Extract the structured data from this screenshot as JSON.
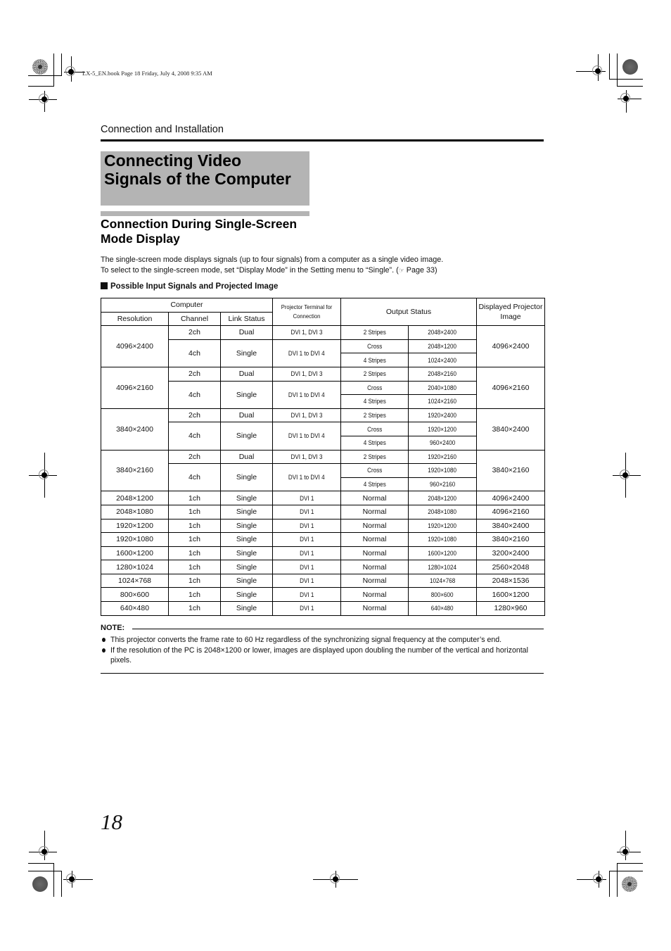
{
  "slug": "LX-5_EN.book  Page 18  Friday, July 4, 2008  9:35 AM",
  "section_header": "Connection and Installation",
  "title_line1": "Connecting Video",
  "title_line2": "Signals of the Computer",
  "subtitle_line1": "Connection During Single-Screen",
  "subtitle_line2": "Mode Display",
  "intro_line1": "The single-screen mode displays signals (up to four signals) from a computer as a single video image.",
  "intro_line2_pre": "To select to the single-screen mode, set “Display Mode” in the Setting menu to “Single”. (",
  "intro_ref_icon": "☞",
  "intro_line2_post": " Page 33)",
  "table_heading": "Possible Input Signals and Projected Image",
  "table": {
    "headers": {
      "computer": "Computer",
      "resolution": "Resolution",
      "channel": "Channel",
      "link_status": "Link Status",
      "terminal": "Projector Terminal for Connection",
      "output_status": "Output Status",
      "displayed": "Displayed Projector Image"
    },
    "groups": [
      {
        "resolution": "4096×2400",
        "displayed": "4096×2400",
        "dual": {
          "channel": "2ch",
          "link": "Dual",
          "terminal": "DVI 1, DVI 3",
          "mode": "2 Stripes",
          "size": "2048×2400"
        },
        "single": {
          "channel": "4ch",
          "link": "Single",
          "terminal": "DVI 1 to DVI 4",
          "outputs": [
            {
              "mode": "Cross",
              "size": "2048×1200"
            },
            {
              "mode": "4 Stripes",
              "size": "1024×2400"
            }
          ]
        }
      },
      {
        "resolution": "4096×2160",
        "displayed": "4096×2160",
        "dual": {
          "channel": "2ch",
          "link": "Dual",
          "terminal": "DVI 1, DVI 3",
          "mode": "2 Stripes",
          "size": "2048×2160"
        },
        "single": {
          "channel": "4ch",
          "link": "Single",
          "terminal": "DVI 1 to DVI 4",
          "outputs": [
            {
              "mode": "Cross",
              "size": "2040×1080"
            },
            {
              "mode": "4 Stripes",
              "size": "1024×2160"
            }
          ]
        }
      },
      {
        "resolution": "3840×2400",
        "displayed": "3840×2400",
        "dual": {
          "channel": "2ch",
          "link": "Dual",
          "terminal": "DVI 1, DVI 3",
          "mode": "2 Stripes",
          "size": "1920×2400"
        },
        "single": {
          "channel": "4ch",
          "link": "Single",
          "terminal": "DVI 1 to DVI 4",
          "outputs": [
            {
              "mode": "Cross",
              "size": "1920×1200"
            },
            {
              "mode": "4 Stripes",
              "size": "960×2400"
            }
          ]
        }
      },
      {
        "resolution": "3840×2160",
        "displayed": "3840×2160",
        "dual": {
          "channel": "2ch",
          "link": "Dual",
          "terminal": "DVI 1, DVI 3",
          "mode": "2 Stripes",
          "size": "1920×2160"
        },
        "single": {
          "channel": "4ch",
          "link": "Single",
          "terminal": "DVI 1 to DVI 4",
          "outputs": [
            {
              "mode": "Cross",
              "size": "1920×1080"
            },
            {
              "mode": "4 Stripes",
              "size": "960×2160"
            }
          ]
        }
      }
    ],
    "simple_rows": [
      {
        "resolution": "2048×1200",
        "channel": "1ch",
        "link": "Single",
        "terminal": "DVI 1",
        "mode": "Normal",
        "size": "2048×1200",
        "displayed": "4096×2400"
      },
      {
        "resolution": "2048×1080",
        "channel": "1ch",
        "link": "Single",
        "terminal": "DVI 1",
        "mode": "Normal",
        "size": "2048×1080",
        "displayed": "4096×2160"
      },
      {
        "resolution": "1920×1200",
        "channel": "1ch",
        "link": "Single",
        "terminal": "DVI 1",
        "mode": "Normal",
        "size": "1920×1200",
        "displayed": "3840×2400"
      },
      {
        "resolution": "1920×1080",
        "channel": "1ch",
        "link": "Single",
        "terminal": "DVI 1",
        "mode": "Normal",
        "size": "1920×1080",
        "displayed": "3840×2160"
      },
      {
        "resolution": "1600×1200",
        "channel": "1ch",
        "link": "Single",
        "terminal": "DVI 1",
        "mode": "Normal",
        "size": "1600×1200",
        "displayed": "3200×2400"
      },
      {
        "resolution": "1280×1024",
        "channel": "1ch",
        "link": "Single",
        "terminal": "DVI 1",
        "mode": "Normal",
        "size": "1280×1024",
        "displayed": "2560×2048"
      },
      {
        "resolution": "1024×768",
        "channel": "1ch",
        "link": "Single",
        "terminal": "DVI 1",
        "mode": "Normal",
        "size": "1024×768",
        "displayed": "2048×1536"
      },
      {
        "resolution": "800×600",
        "channel": "1ch",
        "link": "Single",
        "terminal": "DVI 1",
        "mode": "Normal",
        "size": "800×600",
        "displayed": "1600×1200"
      },
      {
        "resolution": "640×480",
        "channel": "1ch",
        "link": "Single",
        "terminal": "DVI 1",
        "mode": "Normal",
        "size": "640×480",
        "displayed": "1280×960"
      }
    ]
  },
  "note_label": "NOTE:",
  "notes": [
    "This projector converts the frame rate to 60 Hz regardless of the synchronizing signal frequency at the computer’s end.",
    "If the resolution of the PC is 2048×1200 or lower, images are displayed upon doubling the number of the vertical and horizontal pixels."
  ],
  "page_number": "18"
}
